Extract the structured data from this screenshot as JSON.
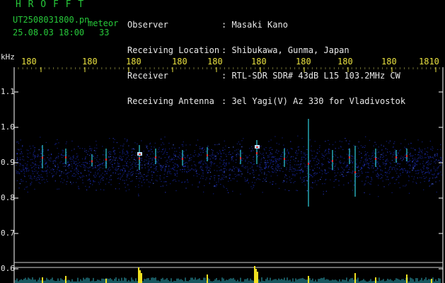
{
  "header": {
    "brand": "H R O F F T",
    "filename": "UT2508031800.pn",
    "date_time": "25.08.03 18:00",
    "count": "33",
    "meteor_label": "meteor"
  },
  "info": {
    "labels": [
      "Observer",
      "Receiving Location",
      "Receiver",
      "Receiving Antenna"
    ],
    "values": [
      ": Masaki Kano",
      ": Shibukawa, Gunma, Japan",
      ": RTL-SDR SDR# 43dB L15 103.2MHz CW",
      ": 3el Yagi(V) Az 330 for Vladivostok"
    ]
  },
  "axis": {
    "unit": "kHz",
    "time_ticks": [
      "180",
      "180",
      "180",
      "180",
      "180",
      "180",
      "180",
      "180",
      "180",
      "1810"
    ],
    "freq_ticks": [
      "1.1",
      "1.0",
      "0.9",
      "0.8",
      "0.7",
      "0.6"
    ]
  },
  "colors": {
    "header_green": "#27c83a",
    "text_white": "#e8e8e8",
    "tick_yellow": "#e8e040",
    "noise_band": "#1a2aa0",
    "echo_cyan": "#30d0e0",
    "echo_red": "#e03030",
    "meteor_bars": "#f0e020"
  }
}
